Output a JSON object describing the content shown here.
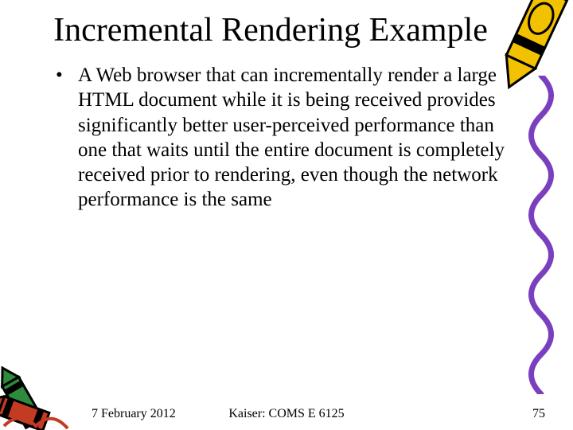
{
  "title": "Incremental Rendering Example",
  "bullet": "A Web browser that can incrementally render a large HTML document while it is being received provides significantly better user-perceived performance than one that waits until the entire document is completely received prior to rendering, even though the network performance is the same",
  "footer": {
    "date": "7 February 2012",
    "mid": "Kaiser: COMS E 6125",
    "page": "75"
  }
}
